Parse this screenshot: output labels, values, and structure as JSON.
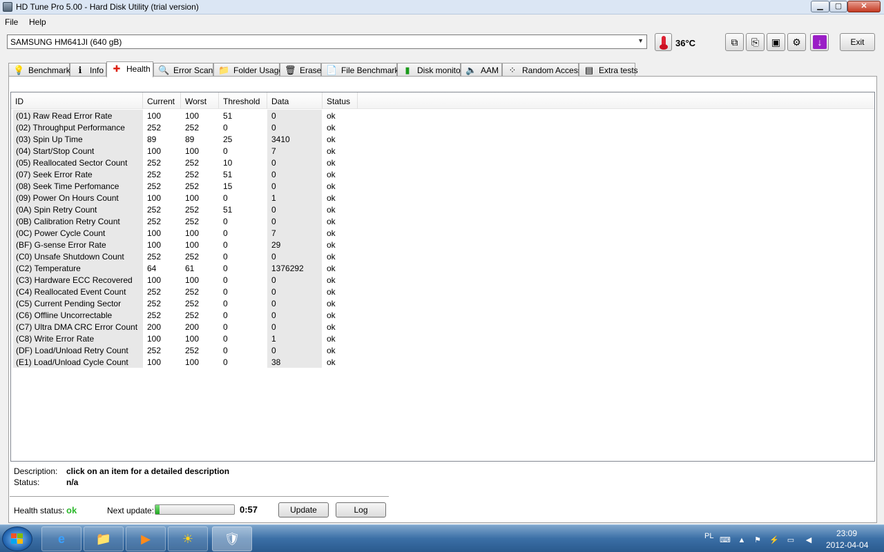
{
  "window": {
    "title": "HD Tune Pro 5.00 - Hard Disk Utility (trial version)"
  },
  "menu": {
    "file": "File",
    "help": "Help"
  },
  "toolbar": {
    "drive": "SAMSUNG HM641JI (640 gB)",
    "temperature": "36°C",
    "exit_label": "Exit"
  },
  "tabs": [
    {
      "label": "Benchmark",
      "icon": "bulb-icon"
    },
    {
      "label": "Info",
      "icon": "info-icon"
    },
    {
      "label": "Health",
      "icon": "health-cross-icon"
    },
    {
      "label": "Error Scan",
      "icon": "magnifier-icon"
    },
    {
      "label": "Folder Usage",
      "icon": "folder-icon"
    },
    {
      "label": "Erase",
      "icon": "trash-icon"
    },
    {
      "label": "File Benchmark",
      "icon": "file-benchmark-icon"
    },
    {
      "label": "Disk monitor",
      "icon": "chart-icon"
    },
    {
      "label": "AAM",
      "icon": "speaker-icon"
    },
    {
      "label": "Random Access",
      "icon": "dots-icon"
    },
    {
      "label": "Extra tests",
      "icon": "extra-tests-icon"
    }
  ],
  "table": {
    "columns": [
      "ID",
      "Current",
      "Worst",
      "Threshold",
      "Data",
      "Status"
    ],
    "rows": [
      [
        "(01) Raw Read Error Rate",
        "100",
        "100",
        "51",
        "0",
        "ok"
      ],
      [
        "(02) Throughput Performance",
        "252",
        "252",
        "0",
        "0",
        "ok"
      ],
      [
        "(03) Spin Up Time",
        "89",
        "89",
        "25",
        "3410",
        "ok"
      ],
      [
        "(04) Start/Stop Count",
        "100",
        "100",
        "0",
        "7",
        "ok"
      ],
      [
        "(05) Reallocated Sector Count",
        "252",
        "252",
        "10",
        "0",
        "ok"
      ],
      [
        "(07) Seek Error Rate",
        "252",
        "252",
        "51",
        "0",
        "ok"
      ],
      [
        "(08) Seek Time Perfomance",
        "252",
        "252",
        "15",
        "0",
        "ok"
      ],
      [
        "(09) Power On Hours Count",
        "100",
        "100",
        "0",
        "1",
        "ok"
      ],
      [
        "(0A) Spin Retry Count",
        "252",
        "252",
        "51",
        "0",
        "ok"
      ],
      [
        "(0B) Calibration Retry Count",
        "252",
        "252",
        "0",
        "0",
        "ok"
      ],
      [
        "(0C) Power Cycle Count",
        "100",
        "100",
        "0",
        "7",
        "ok"
      ],
      [
        "(BF) G-sense Error Rate",
        "100",
        "100",
        "0",
        "29",
        "ok"
      ],
      [
        "(C0) Unsafe Shutdown Count",
        "252",
        "252",
        "0",
        "0",
        "ok"
      ],
      [
        "(C2) Temperature",
        "64",
        "61",
        "0",
        "1376292",
        "ok"
      ],
      [
        "(C3) Hardware ECC Recovered",
        "100",
        "100",
        "0",
        "0",
        "ok"
      ],
      [
        "(C4) Reallocated Event Count",
        "252",
        "252",
        "0",
        "0",
        "ok"
      ],
      [
        "(C5) Current Pending Sector",
        "252",
        "252",
        "0",
        "0",
        "ok"
      ],
      [
        "(C6) Offline Uncorrectable",
        "252",
        "252",
        "0",
        "0",
        "ok"
      ],
      [
        "(C7) Ultra DMA CRC Error Count",
        "200",
        "200",
        "0",
        "0",
        "ok"
      ],
      [
        "(C8) Write Error Rate",
        "100",
        "100",
        "0",
        "1",
        "ok"
      ],
      [
        "(DF) Load/Unload Retry Count",
        "252",
        "252",
        "0",
        "0",
        "ok"
      ],
      [
        "(E1) Load/Unload Cycle Count",
        "100",
        "100",
        "0",
        "38",
        "ok"
      ]
    ]
  },
  "details": {
    "description_label": "Description:",
    "description_value": "click on an item for a detailed description",
    "status_label": "Status:",
    "status_value": "n/a"
  },
  "health": {
    "label": "Health status:",
    "value": "ok",
    "value_color": "#2db82d",
    "next_update_label": "Next update:",
    "next_update_progress": 0.05,
    "countdown": "0:57",
    "update_button": "Update",
    "log_button": "Log"
  },
  "taskbar": {
    "language": "PL",
    "time": "23:09",
    "date": "2012-04-04"
  }
}
